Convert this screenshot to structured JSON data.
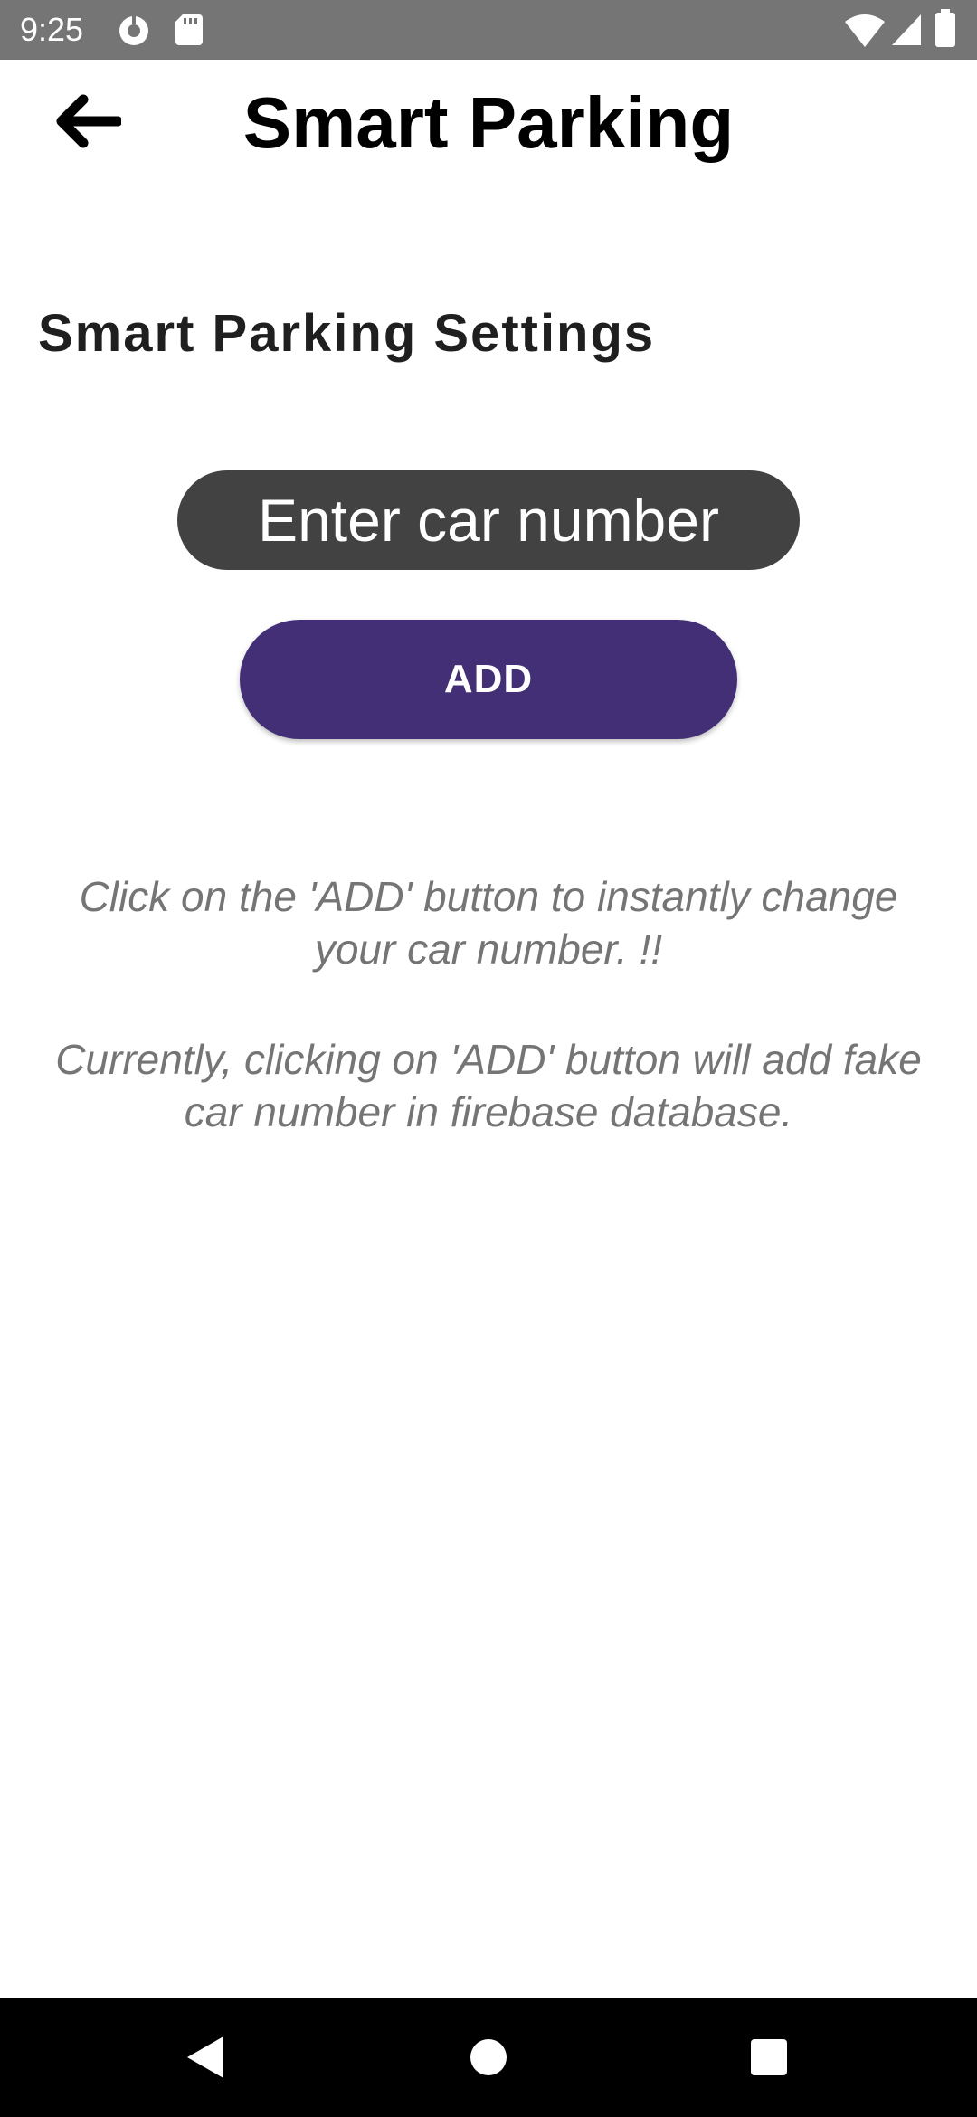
{
  "status_bar": {
    "time": "9:25",
    "left_icons": [
      "data-saver-icon",
      "sd-card-icon"
    ],
    "right_icons": [
      "wifi-icon",
      "cell-signal-icon",
      "battery-icon"
    ],
    "background": "#757575"
  },
  "app_bar": {
    "title": "Smart Parking",
    "back_icon": "arrow-left-icon"
  },
  "main": {
    "section_title": "Smart Parking Settings",
    "car_input": {
      "placeholder": "Enter car number",
      "value": ""
    },
    "add_button_label": "ADD",
    "info_line_1": "Click on the 'ADD' button to instantly change your car number. !!",
    "info_line_2": "Currently, clicking on 'ADD' button will add fake car number in firebase database."
  },
  "nav_bar": {
    "buttons": [
      "back-triangle-icon",
      "home-circle-icon",
      "recents-square-icon"
    ]
  },
  "colors": {
    "input_background": "#424242",
    "button_accent": "#432f75",
    "info_text": "#757575"
  }
}
